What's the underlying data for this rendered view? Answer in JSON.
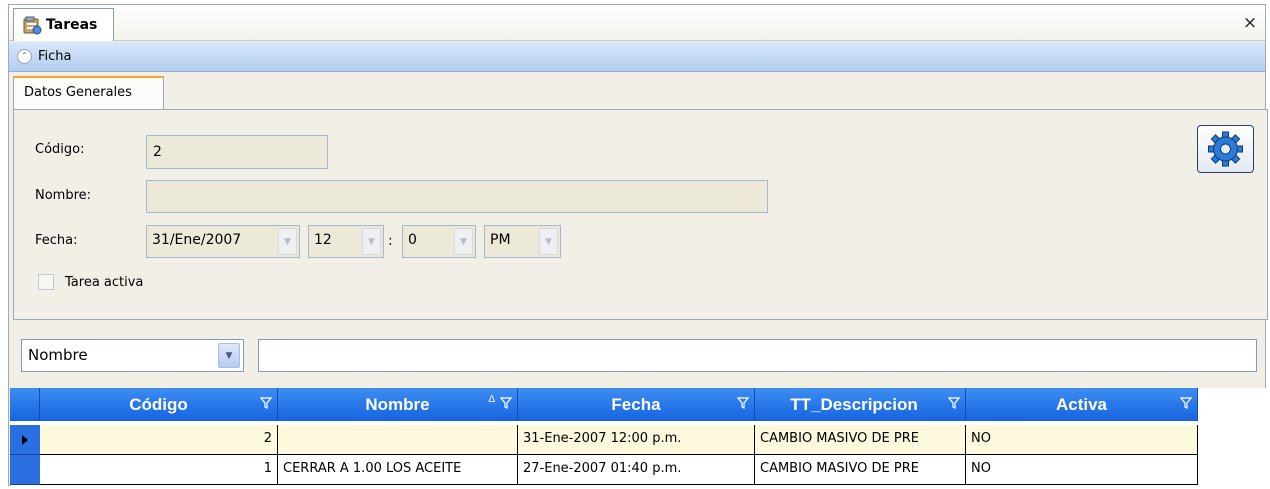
{
  "window": {
    "title": "Tareas",
    "close_glyph": "×"
  },
  "section": {
    "label": "Ficha"
  },
  "tabs": [
    {
      "label": "Datos Generales"
    }
  ],
  "form": {
    "codigo_label": "Código:",
    "codigo_value": "2",
    "nombre_label": "Nombre:",
    "nombre_value": "",
    "fecha_label": "Fecha:",
    "fecha_date": "31/Ene/2007",
    "fecha_hour": "12",
    "time_sep": ":",
    "fecha_minute": "0",
    "fecha_ampm": "PM",
    "activa_label": "Tarea activa",
    "activa_checked": false
  },
  "search": {
    "field_selected": "Nombre",
    "query": ""
  },
  "grid": {
    "columns": [
      {
        "label": "Código",
        "sort": ""
      },
      {
        "label": "Nombre",
        "sort": "Δ"
      },
      {
        "label": "Fecha",
        "sort": ""
      },
      {
        "label": "TT_Descripcion",
        "sort": ""
      },
      {
        "label": "Activa",
        "sort": ""
      }
    ],
    "rows": [
      {
        "codigo": "2",
        "nombre": "",
        "fecha": "31-Ene-2007 12:00 p.m.",
        "descripcion": "CAMBIO MASIVO DE PRE",
        "activa": "NO",
        "selected": true
      },
      {
        "codigo": "1",
        "nombre": "CERRAR A 1.00 LOS ACEITE",
        "fecha": "27-Ene-2007 01:40 p.m.",
        "descripcion": "CAMBIO MASIVO DE PRE",
        "activa": "NO",
        "selected": false
      }
    ]
  },
  "icons": {
    "title": "tasks-icon",
    "collapse": "chevron-up-double-icon",
    "gear": "gear-icon",
    "filter": "filter-icon",
    "row_indicator": "triangle-right-icon"
  },
  "colors": {
    "header_blue": "#1a6ae4",
    "selected_row": "#fdf9dd",
    "ficha_bar": "#c3d7f4"
  }
}
